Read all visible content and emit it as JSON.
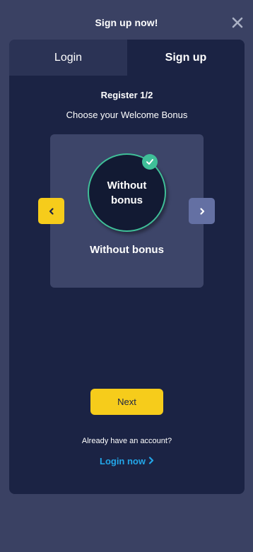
{
  "header": {
    "title": "Sign up now!",
    "close_icon": "close-icon"
  },
  "tabs": [
    {
      "label": "Login",
      "active": false
    },
    {
      "label": "Sign up",
      "active": true
    }
  ],
  "register": {
    "step": "Register 1/2",
    "subtitle": "Choose your Welcome Bonus"
  },
  "bonus": {
    "circle_label": "Without bonus",
    "name": "Without bonus",
    "selected": true
  },
  "carousel": {
    "prev_icon": "chevron-left-icon",
    "next_icon": "chevron-right-icon"
  },
  "actions": {
    "next_label": "Next",
    "account_text": "Already have an account?",
    "login_link": "Login now"
  },
  "colors": {
    "page_bg": "#3a4163",
    "panel_bg": "#1b2344",
    "inactive_tab_bg": "#2b3355",
    "card_bg": "#3d4569",
    "accent_yellow": "#f6cc1b",
    "accent_green": "#3fbf98",
    "link_blue": "#23a6e8",
    "next_arrow_bg": "#6470a3"
  }
}
